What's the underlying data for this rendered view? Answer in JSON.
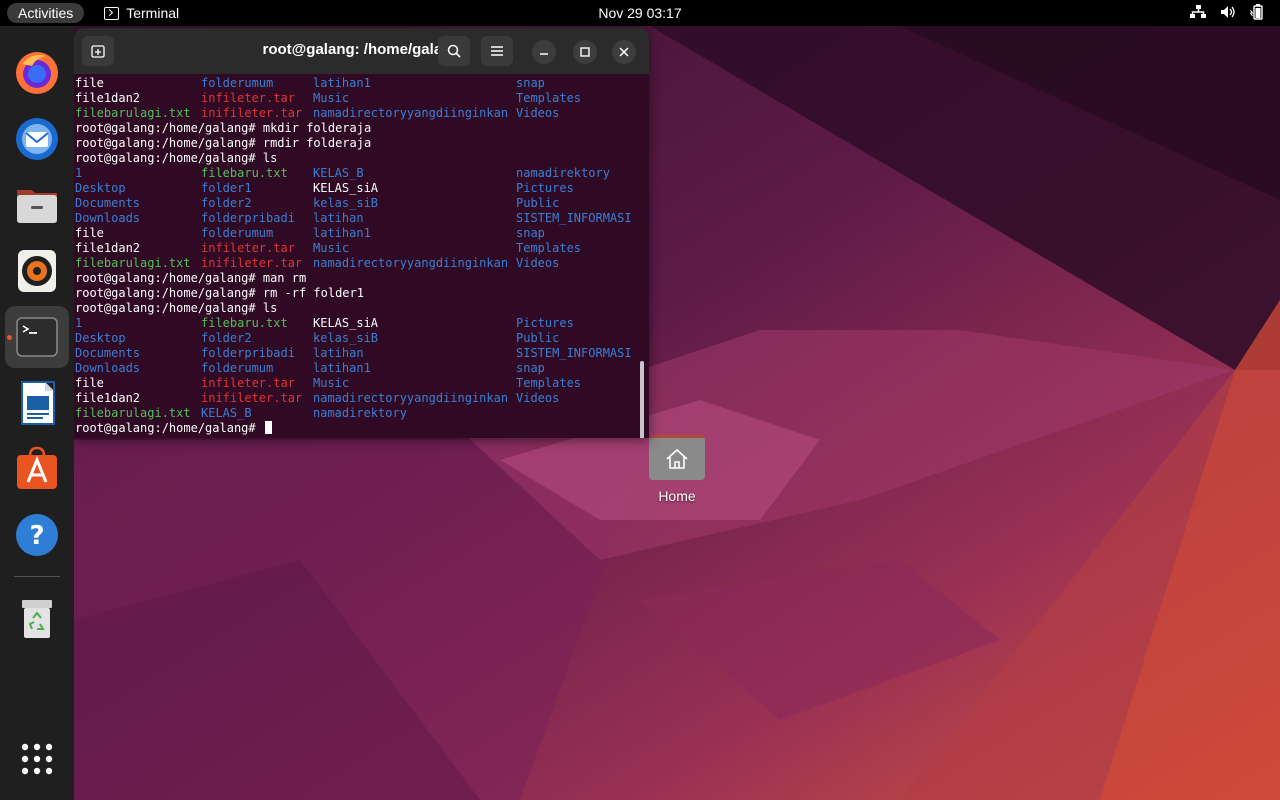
{
  "topbar": {
    "activities": "Activities",
    "app_name": "Terminal",
    "clock": "Nov 29  03:17"
  },
  "dock": {
    "apps": [
      "firefox-icon",
      "thunderbird-icon",
      "files-icon",
      "rhythmbox-icon",
      "terminal-icon",
      "writer-icon",
      "app-center-icon",
      "help-icon",
      "trash-icon",
      "show-apps-icon"
    ]
  },
  "terminal": {
    "title": "root@galang: /home/galang",
    "lines": [
      {
        "type": "ls",
        "cells": [
          {
            "t": "file",
            "c": "white"
          },
          {
            "t": "folderumum",
            "c": "blue"
          },
          {
            "t": "latihan1",
            "c": "blue"
          },
          {
            "t": "snap",
            "c": "blue"
          }
        ]
      },
      {
        "type": "ls",
        "cells": [
          {
            "t": "file1dan2",
            "c": "white"
          },
          {
            "t": "infileter.tar",
            "c": "red"
          },
          {
            "t": "Music",
            "c": "blue"
          },
          {
            "t": "Templates",
            "c": "blue"
          }
        ]
      },
      {
        "type": "ls",
        "cells": [
          {
            "t": "filebarulagi.txt",
            "c": "green"
          },
          {
            "t": "inifileter.tar",
            "c": "red"
          },
          {
            "t": "namadirectoryyangdiinginkan",
            "c": "blue"
          },
          {
            "t": "Videos",
            "c": "blue"
          }
        ]
      },
      {
        "type": "cmd",
        "text": "root@galang:/home/galang# mkdir folderaja"
      },
      {
        "type": "cmd",
        "text": "root@galang:/home/galang# rmdir folderaja"
      },
      {
        "type": "cmd",
        "text": "root@galang:/home/galang# ls"
      },
      {
        "type": "ls",
        "cells": [
          {
            "t": "1",
            "c": "blue"
          },
          {
            "t": "filebaru.txt",
            "c": "green"
          },
          {
            "t": "KELAS_B",
            "c": "blue"
          },
          {
            "t": "namadirektory",
            "c": "blue"
          }
        ]
      },
      {
        "type": "ls",
        "cells": [
          {
            "t": "Desktop",
            "c": "blue"
          },
          {
            "t": "folder1",
            "c": "blue"
          },
          {
            "t": "KELAS_siA",
            "c": "white"
          },
          {
            "t": "Pictures",
            "c": "blue"
          }
        ]
      },
      {
        "type": "ls",
        "cells": [
          {
            "t": "Documents",
            "c": "blue"
          },
          {
            "t": "folder2",
            "c": "blue"
          },
          {
            "t": "kelas_siB",
            "c": "blue"
          },
          {
            "t": "Public",
            "c": "blue"
          }
        ]
      },
      {
        "type": "ls",
        "cells": [
          {
            "t": "Downloads",
            "c": "blue"
          },
          {
            "t": "folderpribadi",
            "c": "blue"
          },
          {
            "t": "latihan",
            "c": "blue"
          },
          {
            "t": "SISTEM_INFORMASI",
            "c": "blue"
          }
        ]
      },
      {
        "type": "ls",
        "cells": [
          {
            "t": "file",
            "c": "white"
          },
          {
            "t": "folderumum",
            "c": "blue"
          },
          {
            "t": "latihan1",
            "c": "blue"
          },
          {
            "t": "snap",
            "c": "blue"
          }
        ]
      },
      {
        "type": "ls",
        "cells": [
          {
            "t": "file1dan2",
            "c": "white"
          },
          {
            "t": "infileter.tar",
            "c": "red"
          },
          {
            "t": "Music",
            "c": "blue"
          },
          {
            "t": "Templates",
            "c": "blue"
          }
        ]
      },
      {
        "type": "ls",
        "cells": [
          {
            "t": "filebarulagi.txt",
            "c": "green"
          },
          {
            "t": "inifileter.tar",
            "c": "red"
          },
          {
            "t": "namadirectoryyangdiinginkan",
            "c": "blue"
          },
          {
            "t": "Videos",
            "c": "blue"
          }
        ]
      },
      {
        "type": "cmd",
        "text": "root@galang:/home/galang# man rm"
      },
      {
        "type": "cmd",
        "text": "root@galang:/home/galang# rm -rf folder1"
      },
      {
        "type": "cmd",
        "text": "root@galang:/home/galang# ls"
      },
      {
        "type": "ls",
        "cells": [
          {
            "t": "1",
            "c": "blue"
          },
          {
            "t": "filebaru.txt",
            "c": "green"
          },
          {
            "t": "KELAS_siA",
            "c": "white"
          },
          {
            "t": "Pictures",
            "c": "blue"
          }
        ]
      },
      {
        "type": "ls",
        "cells": [
          {
            "t": "Desktop",
            "c": "blue"
          },
          {
            "t": "folder2",
            "c": "blue"
          },
          {
            "t": "kelas_siB",
            "c": "blue"
          },
          {
            "t": "Public",
            "c": "blue"
          }
        ]
      },
      {
        "type": "ls",
        "cells": [
          {
            "t": "Documents",
            "c": "blue"
          },
          {
            "t": "folderpribadi",
            "c": "blue"
          },
          {
            "t": "latihan",
            "c": "blue"
          },
          {
            "t": "SISTEM_INFORMASI",
            "c": "blue"
          }
        ]
      },
      {
        "type": "ls",
        "cells": [
          {
            "t": "Downloads",
            "c": "blue"
          },
          {
            "t": "folderumum",
            "c": "blue"
          },
          {
            "t": "latihan1",
            "c": "blue"
          },
          {
            "t": "snap",
            "c": "blue"
          }
        ]
      },
      {
        "type": "ls",
        "cells": [
          {
            "t": "file",
            "c": "white"
          },
          {
            "t": "infileter.tar",
            "c": "red"
          },
          {
            "t": "Music",
            "c": "blue"
          },
          {
            "t": "Templates",
            "c": "blue"
          }
        ]
      },
      {
        "type": "ls",
        "cells": [
          {
            "t": "file1dan2",
            "c": "white"
          },
          {
            "t": "inifileter.tar",
            "c": "red"
          },
          {
            "t": "namadirectoryyangdiinginkan",
            "c": "blue"
          },
          {
            "t": "Videos",
            "c": "blue"
          }
        ]
      },
      {
        "type": "ls",
        "cells": [
          {
            "t": "filebarulagi.txt",
            "c": "green"
          },
          {
            "t": "KELAS_B",
            "c": "blue"
          },
          {
            "t": "namadirektory",
            "c": "blue"
          },
          {
            "t": "",
            "c": "blue"
          }
        ]
      },
      {
        "type": "prompt",
        "text": "root@galang:/home/galang# "
      }
    ]
  },
  "desktop": {
    "home_label": "Home"
  },
  "colors": {
    "terminal_bg": "#300a24",
    "accent": "#e95420",
    "ls_dir": "#3a7fd4",
    "ls_exec": "#4ec25a",
    "ls_archive": "#e03434"
  }
}
